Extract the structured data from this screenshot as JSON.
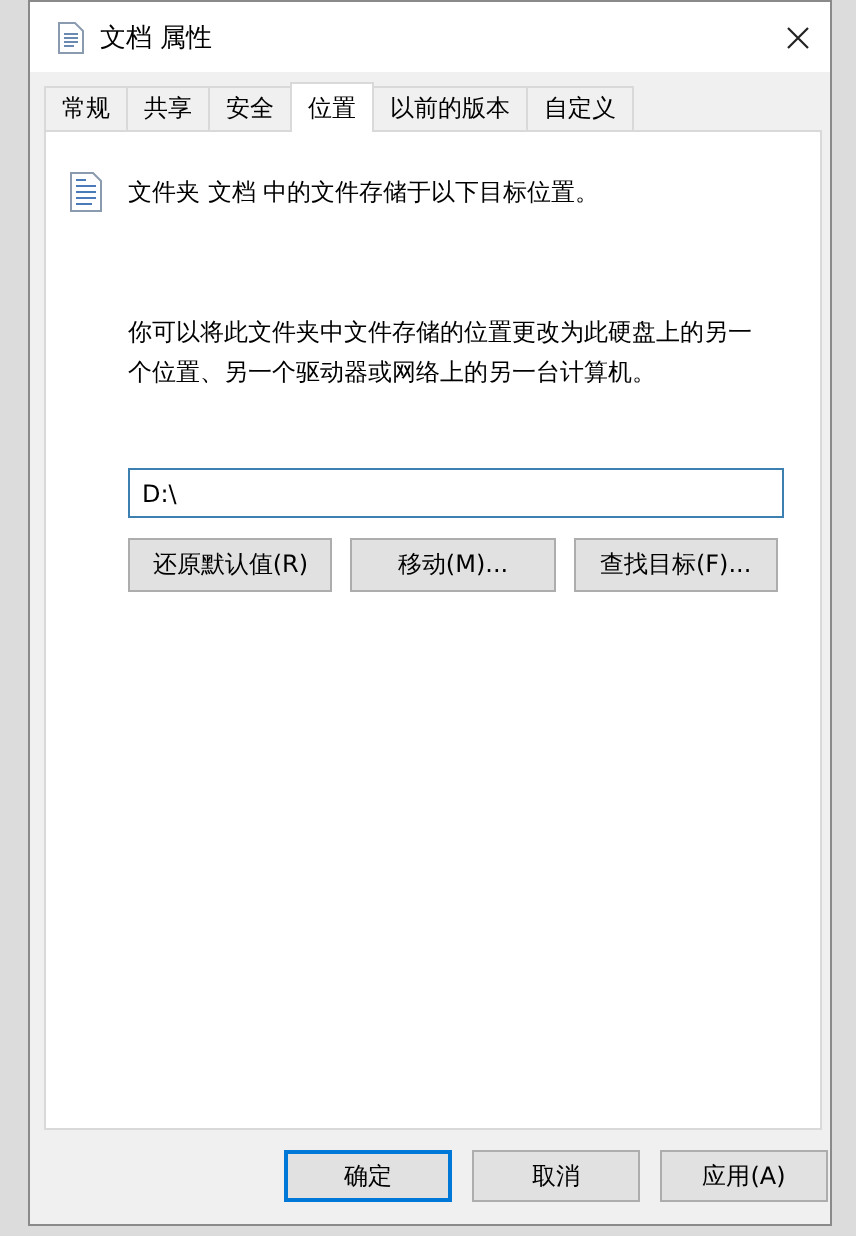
{
  "window": {
    "title": "文档 属性"
  },
  "tabs": [
    {
      "label": "常规",
      "selected": false
    },
    {
      "label": "共享",
      "selected": false
    },
    {
      "label": "安全",
      "selected": false
    },
    {
      "label": "位置",
      "selected": true
    },
    {
      "label": "以前的版本",
      "selected": false
    },
    {
      "label": "自定义",
      "selected": false
    }
  ],
  "location": {
    "description": "文件夹 文档 中的文件存储于以下目标位置。",
    "hint": "你可以将此文件夹中文件存储的位置更改为此硬盘上的另一个位置、另一个驱动器或网络上的另一台计算机。",
    "path": "D:\\",
    "actions": [
      "还原默认值(R)",
      "移动(M)...",
      "查找目标(F)..."
    ]
  },
  "buttons": [
    {
      "label": "确定",
      "default": true
    },
    {
      "label": "取消",
      "default": false
    },
    {
      "label": "应用(A)",
      "default": false
    }
  ]
}
